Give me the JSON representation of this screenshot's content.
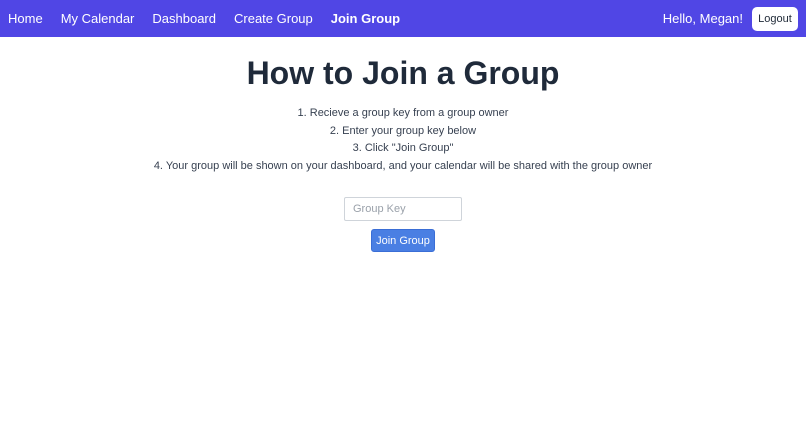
{
  "nav": {
    "links": [
      {
        "label": "Home"
      },
      {
        "label": "My Calendar"
      },
      {
        "label": "Dashboard"
      },
      {
        "label": "Create Group"
      },
      {
        "label": "Join Group"
      }
    ],
    "greeting": "Hello, Megan!",
    "logout_label": "Logout",
    "background_color": "#5046e5"
  },
  "main": {
    "title": "How to Join a Group",
    "steps": [
      "1. Recieve a group key from a group owner",
      "2. Enter your group key below",
      "3. Click \"Join Group\"",
      "4. Your group will be shown on your dashboard, and your calendar will be shared with the group owner"
    ],
    "group_key_placeholder": "Group Key",
    "join_button_label": "Join Group",
    "join_button_color": "#4a7fe3"
  }
}
